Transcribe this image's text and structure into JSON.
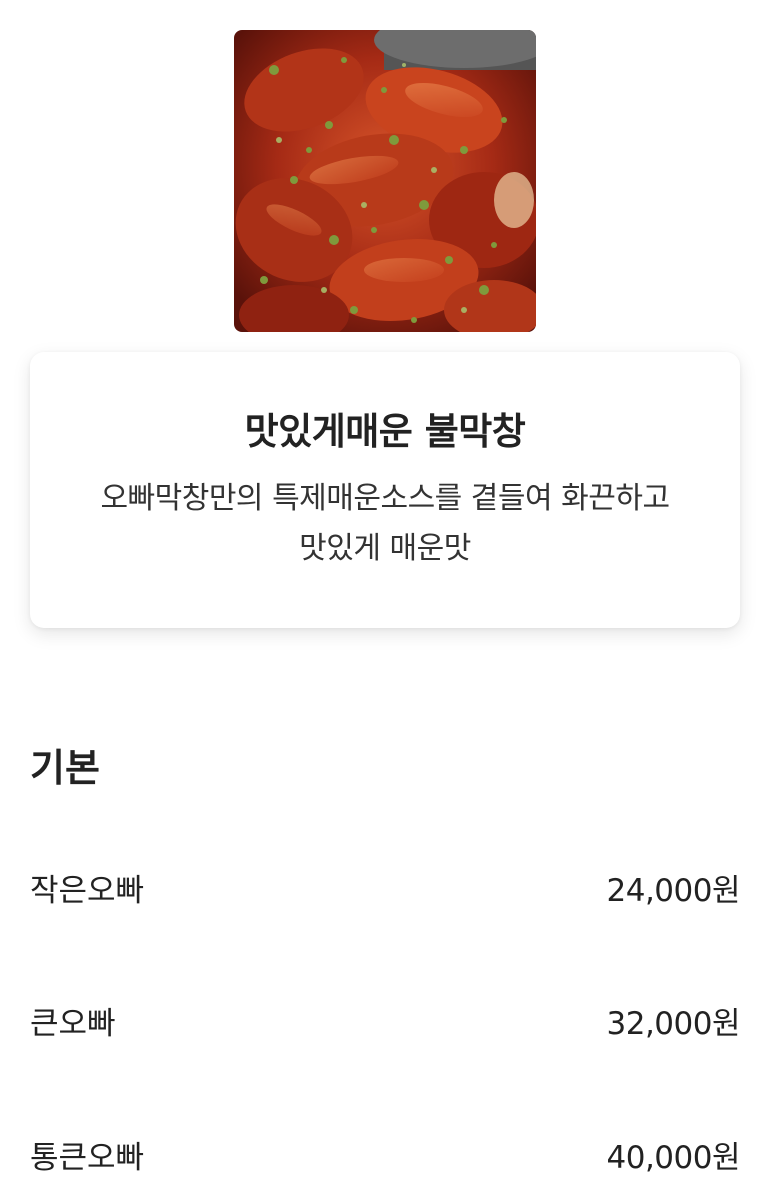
{
  "menu": {
    "image_alt": "불막창 사진",
    "name": "맛있게매운 불막창",
    "description": "오빠막창만의 특제매운소스를 곁들여 화끈하고 맛있게 매운맛"
  },
  "options_section": {
    "title": "기본",
    "items": [
      {
        "label": "작은오빠",
        "price": "24,000원"
      },
      {
        "label": "큰오빠",
        "price": "32,000원"
      },
      {
        "label": "통큰오빠",
        "price": "40,000원"
      }
    ]
  },
  "colors": {
    "text": "#222222",
    "card_bg": "#ffffff",
    "sauce": "#b8331c",
    "herb": "#7f9a3c"
  }
}
